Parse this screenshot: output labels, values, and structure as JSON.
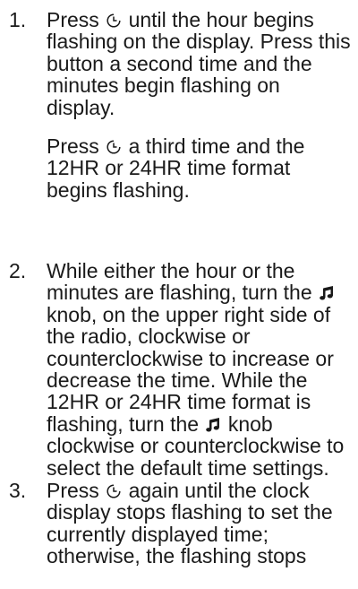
{
  "steps": [
    {
      "number": "1.",
      "paragraphs": [
        {
          "parts": [
            "Press",
            "until the hour begins flashing on the display. Press this button a second time and the minutes begin flashing on display."
          ]
        },
        {
          "parts": [
            "Press",
            "a third time and the 12HR or 24HR time format begins flashing."
          ]
        }
      ]
    },
    {
      "number": "2.",
      "paragraphs": [
        {
          "parts": [
            "While either the hour or the minutes are flashing, turn the",
            "knob, on the upper right side of the radio, clockwise or counterclockwise to increase or decrease the time. While the 12HR or 24HR time format is flashing, turn the",
            "knob clockwise or counterclockwise to select the default time settings."
          ]
        }
      ]
    },
    {
      "number": "3.",
      "paragraphs": [
        {
          "parts": [
            "Press",
            "again until the clock display stops flashing to set the currently displayed time; otherwise, the flashing stops"
          ]
        }
      ]
    }
  ],
  "icons": {
    "clock": "clock-icon",
    "music": "music-note-icon"
  }
}
